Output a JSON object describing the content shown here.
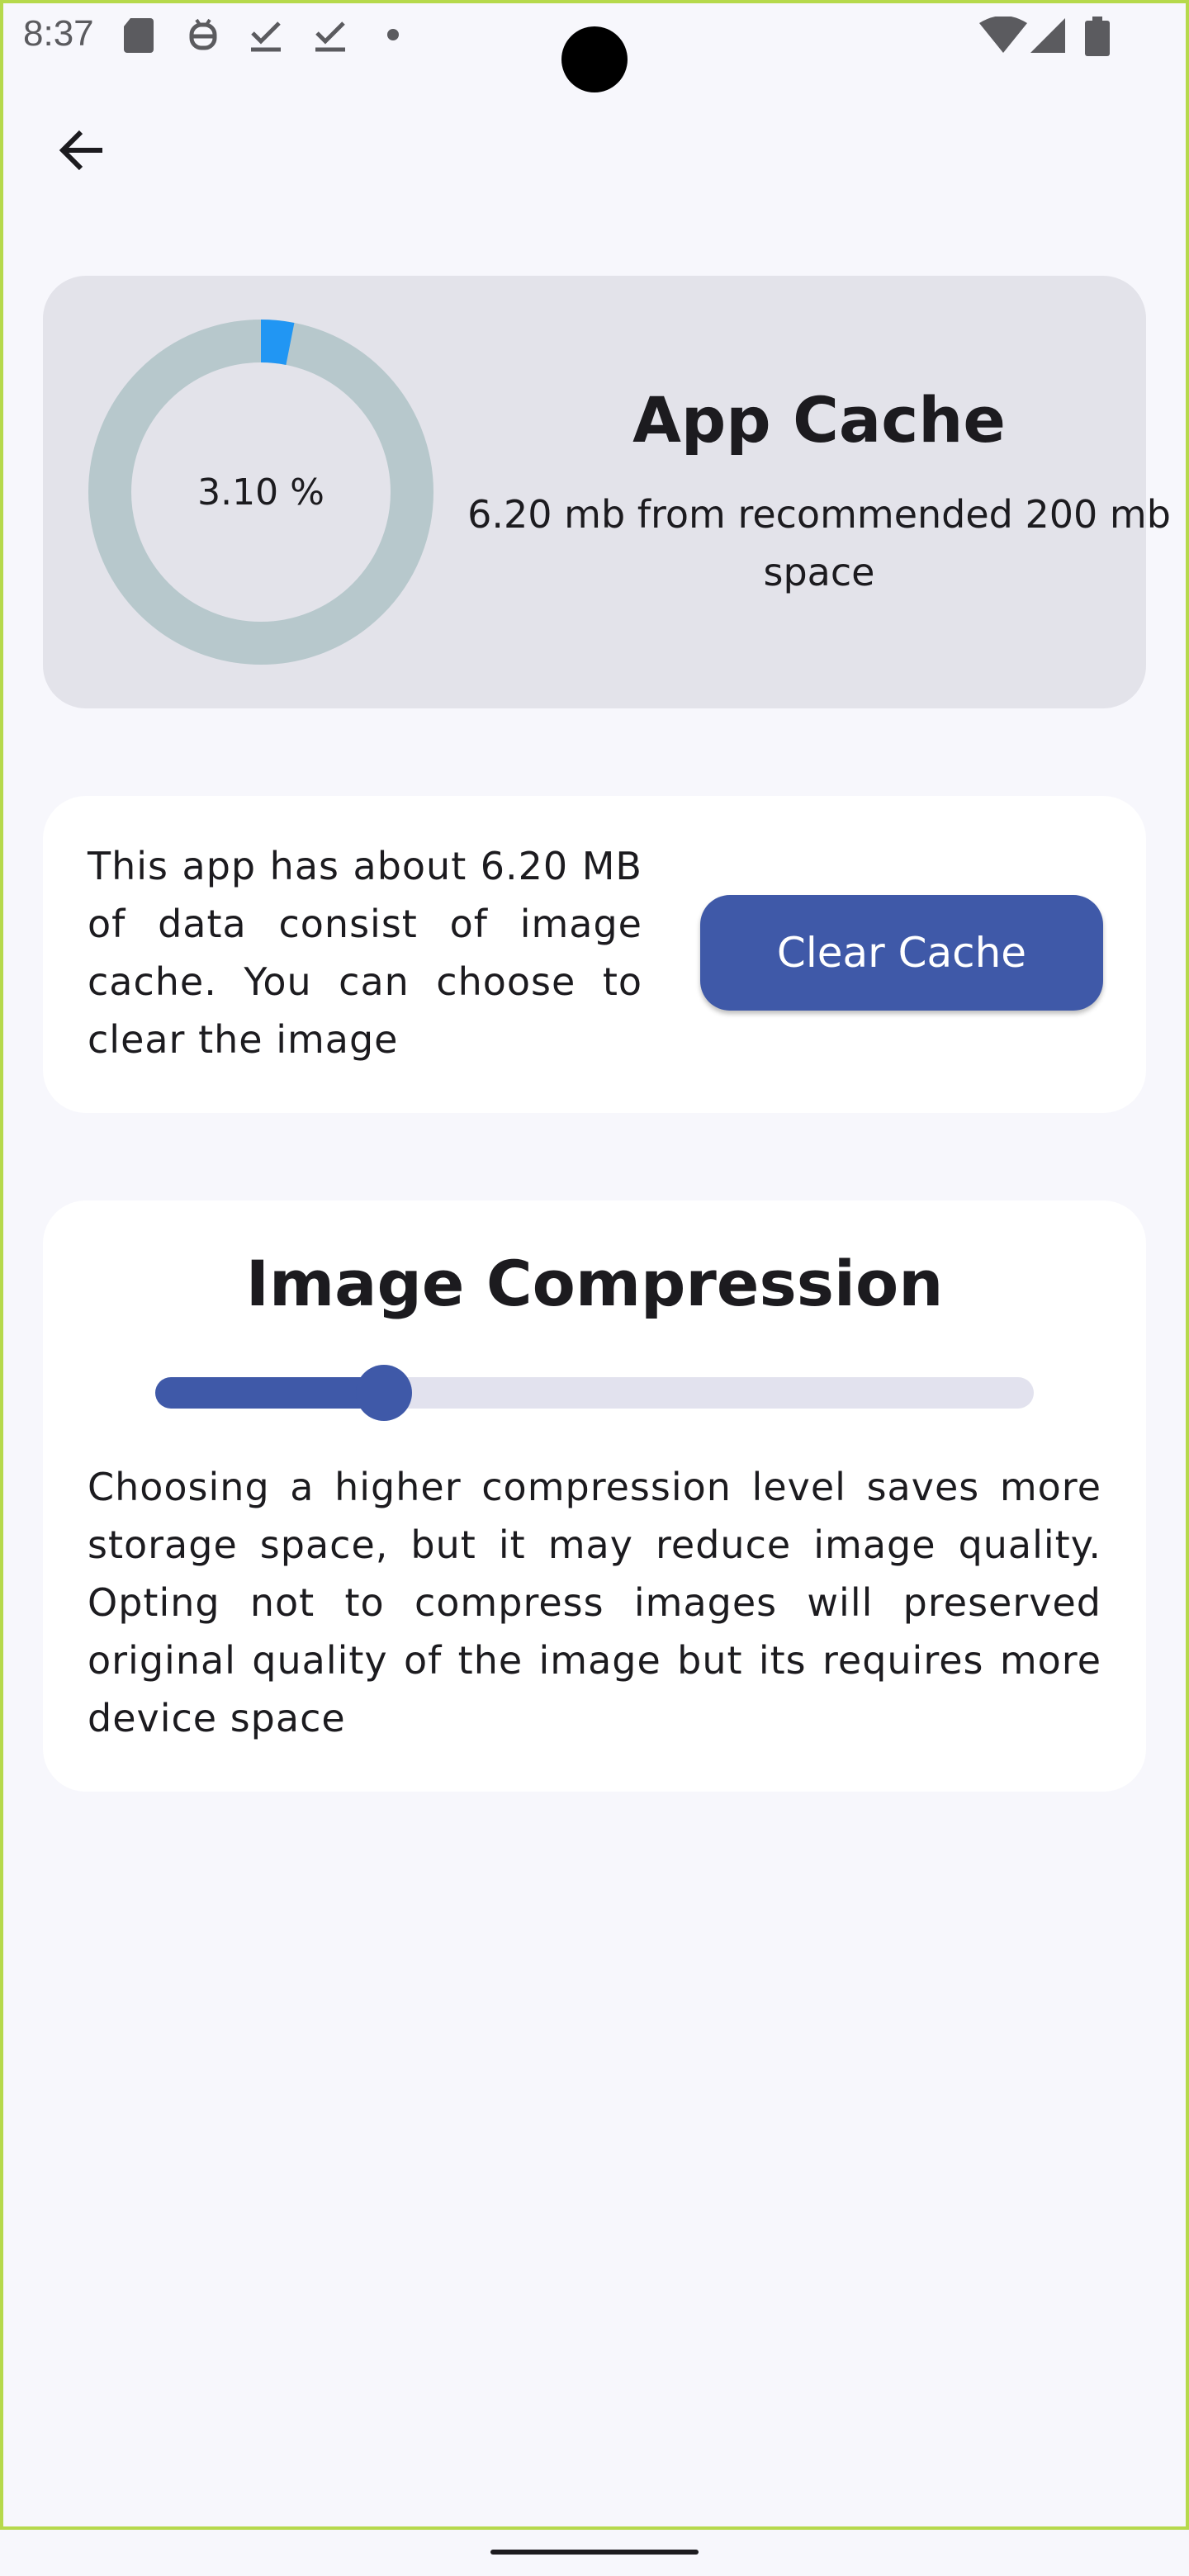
{
  "status_bar": {
    "time": "8:37",
    "icons_left": [
      "sd-card-icon",
      "android-debug-icon",
      "download-done-icon",
      "download-done-icon",
      "dot-icon"
    ],
    "icons_right": [
      "wifi-icon",
      "signal-icon",
      "battery-icon"
    ]
  },
  "nav": {
    "back_icon": "arrow-left-icon"
  },
  "cache_card": {
    "percent_label": "3.10 %",
    "percent_value": 3.1,
    "title": "App Cache",
    "subtitle": "6.20 mb from recommended 200 mb space",
    "ring_color": "#b7c8cc",
    "progress_color": "#2196f3"
  },
  "info_card": {
    "text": "This app has about 6.20 MB of data consist of image cache. You can choose to clear the image",
    "clear_button_label": "Clear Cache"
  },
  "compression_card": {
    "title": "Image Compression",
    "slider_value": 0.26,
    "description": "Choosing a higher compression level saves more storage space, but it may reduce image quality. Opting not to compress images will preserved original quality of the image but its requires more device space"
  },
  "colors": {
    "accent": "#3f59a8",
    "background": "#f7f7fc",
    "cache_card_bg": "#e3e3ea"
  }
}
